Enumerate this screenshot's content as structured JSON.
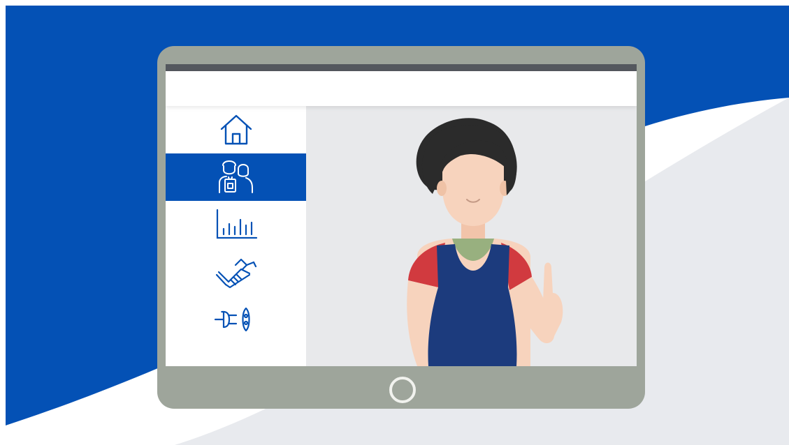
{
  "colors": {
    "brand_blue": "#0451b5",
    "tablet_frame": "#9ea59b",
    "screen_bg": "#e8e9eb",
    "top_bar": "#54585e",
    "shape_grey": "#e8eaee",
    "hair": "#2b2b2b",
    "skin": "#f7d3bd",
    "sleeve_red": "#d13a3f",
    "apron_navy": "#1c3b7d",
    "shirt_green": "#98b07f"
  },
  "header": {
    "title": ""
  },
  "sidebar": {
    "items": [
      {
        "icon": "home-icon",
        "active": false
      },
      {
        "icon": "people-id-badge-icon",
        "active": true
      },
      {
        "icon": "bar-chart-icon",
        "active": false
      },
      {
        "icon": "handshake-icon",
        "active": false
      },
      {
        "icon": "power-plug-icon",
        "active": false
      }
    ]
  },
  "illustration": {
    "subject": "woman-pointing-up"
  }
}
